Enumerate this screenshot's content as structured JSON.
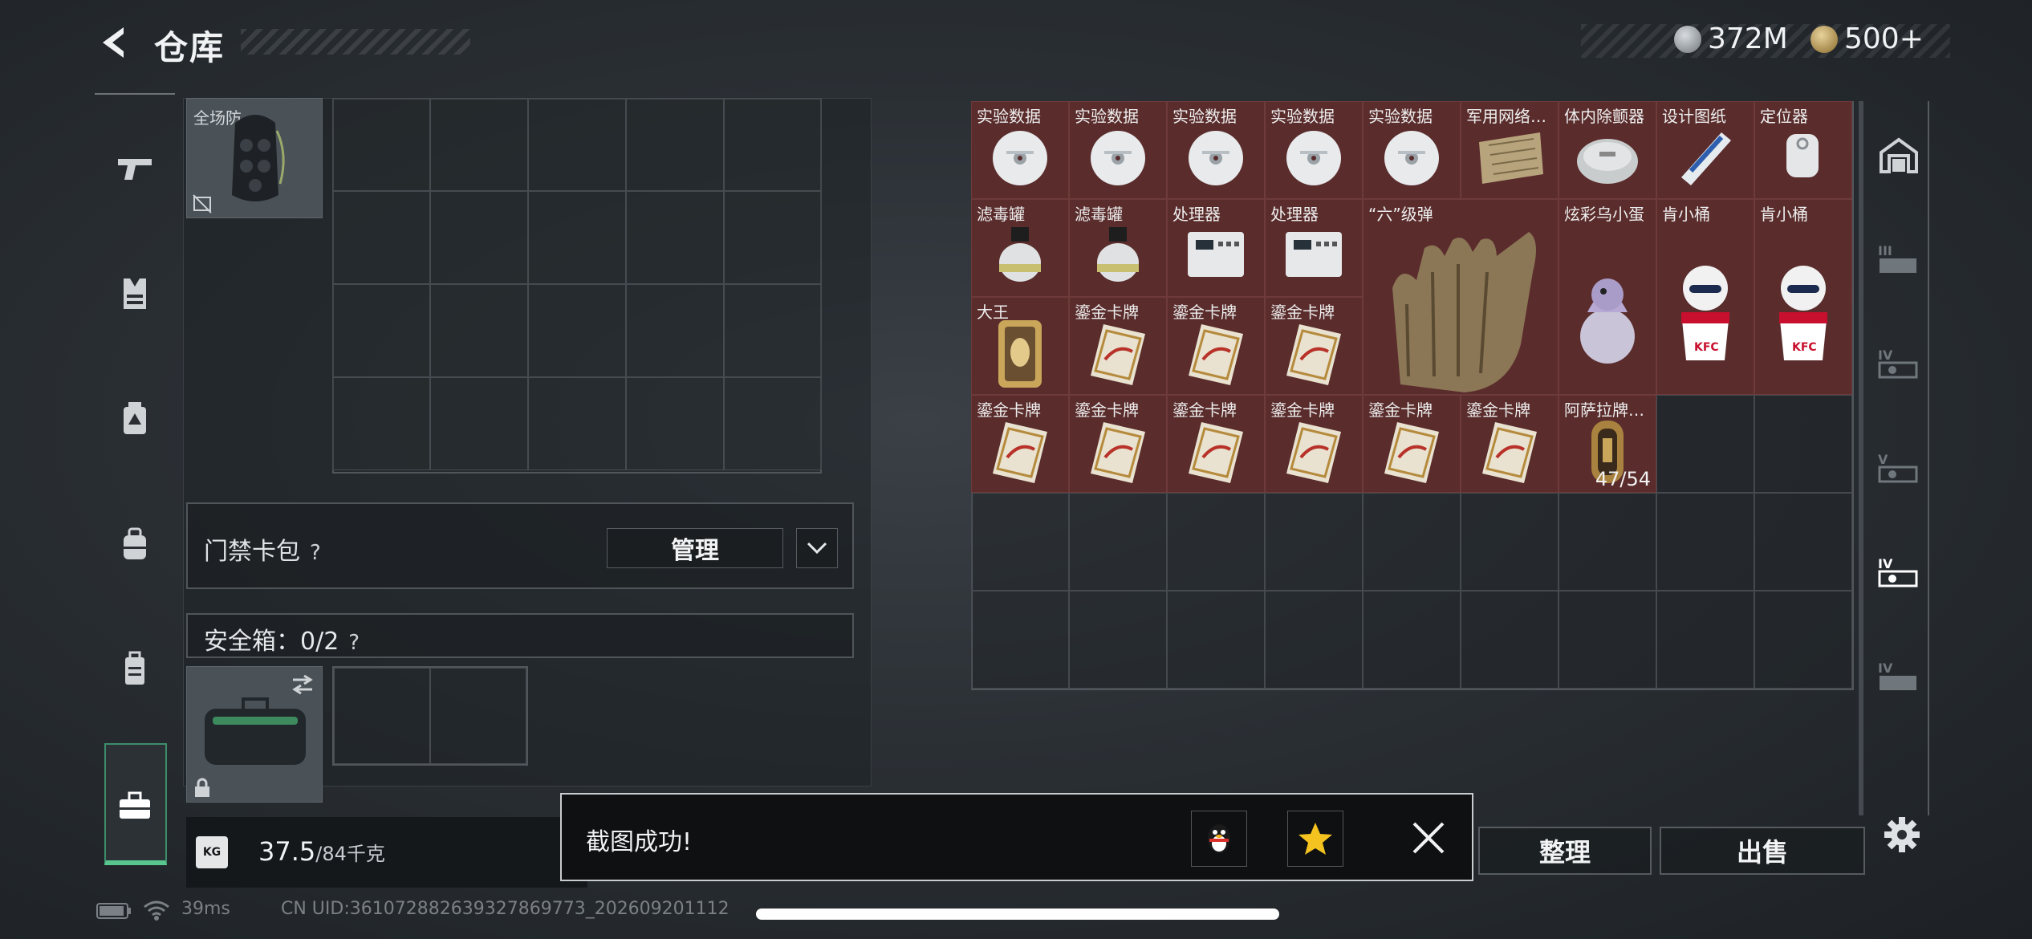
{
  "header": {
    "title": "仓库"
  },
  "currency": {
    "coins": "372M",
    "premium": "500+"
  },
  "equipment": {
    "backpack_label": "全场防",
    "keycard_label": "门禁卡包",
    "help": "?",
    "manage_label": "管理",
    "safebox_label": "安全箱：0/2",
    "weight_current": "37.5",
    "weight_max": "/84千克",
    "weight_icon_text": "KG"
  },
  "stash_items": [
    {
      "name": "实验数据",
      "icon": "data-disc-icon"
    },
    {
      "name": "实验数据",
      "icon": "data-disc-icon"
    },
    {
      "name": "实验数据",
      "icon": "data-disc-icon"
    },
    {
      "name": "实验数据",
      "icon": "data-disc-icon"
    },
    {
      "name": "实验数据",
      "icon": "data-disc-icon"
    },
    {
      "name": "军用网络…",
      "icon": "circuit-board-icon"
    },
    {
      "name": "体内除颤器",
      "icon": "defibrillator-icon"
    },
    {
      "name": "设计图纸",
      "icon": "blueprint-icon"
    },
    {
      "name": "定位器",
      "icon": "locator-icon"
    },
    {
      "name": "滤毒罐",
      "icon": "filter-canister-icon"
    },
    {
      "name": "滤毒罐",
      "icon": "filter-canister-icon"
    },
    {
      "name": "处理器",
      "icon": "processor-icon"
    },
    {
      "name": "处理器",
      "icon": "processor-icon"
    },
    {
      "name": "“六”级弹",
      "icon": "gauntlet-statue-icon"
    },
    {
      "name": "炫彩乌小蛋",
      "icon": "egg-figurine-icon"
    },
    {
      "name": "肯小桶",
      "icon": "kfc-figurine-icon"
    },
    {
      "name": "肯小桶",
      "icon": "kfc-figurine-icon"
    },
    {
      "name": "大王",
      "icon": "gold-card-icon"
    },
    {
      "name": "鎏金卡牌",
      "icon": "gilded-card-icon"
    },
    {
      "name": "鎏金卡牌",
      "icon": "gilded-card-icon"
    },
    {
      "name": "鎏金卡牌",
      "icon": "gilded-card-icon"
    },
    {
      "name": "鎏金卡牌",
      "icon": "gilded-card-icon"
    },
    {
      "name": "鎏金卡牌",
      "icon": "gilded-card-icon"
    },
    {
      "name": "鎏金卡牌",
      "icon": "gilded-card-icon"
    },
    {
      "name": "鎏金卡牌",
      "icon": "gilded-card-icon"
    },
    {
      "name": "鎏金卡牌",
      "icon": "gilded-card-icon"
    },
    {
      "name": "鎏金卡牌",
      "icon": "gilded-card-icon"
    },
    {
      "name": "阿萨拉牌…",
      "icon": "asara-token-icon",
      "qty": "47/54"
    }
  ],
  "actions": {
    "sort": "整理",
    "sell": "出售"
  },
  "toast": {
    "text": "截图成功!"
  },
  "status": {
    "ping": "39ms",
    "uid": "CN UID:361072882639327869773_202609201112"
  },
  "colors": {
    "item_bg": "#5a2c2c",
    "accent_green": "#58c78f"
  }
}
